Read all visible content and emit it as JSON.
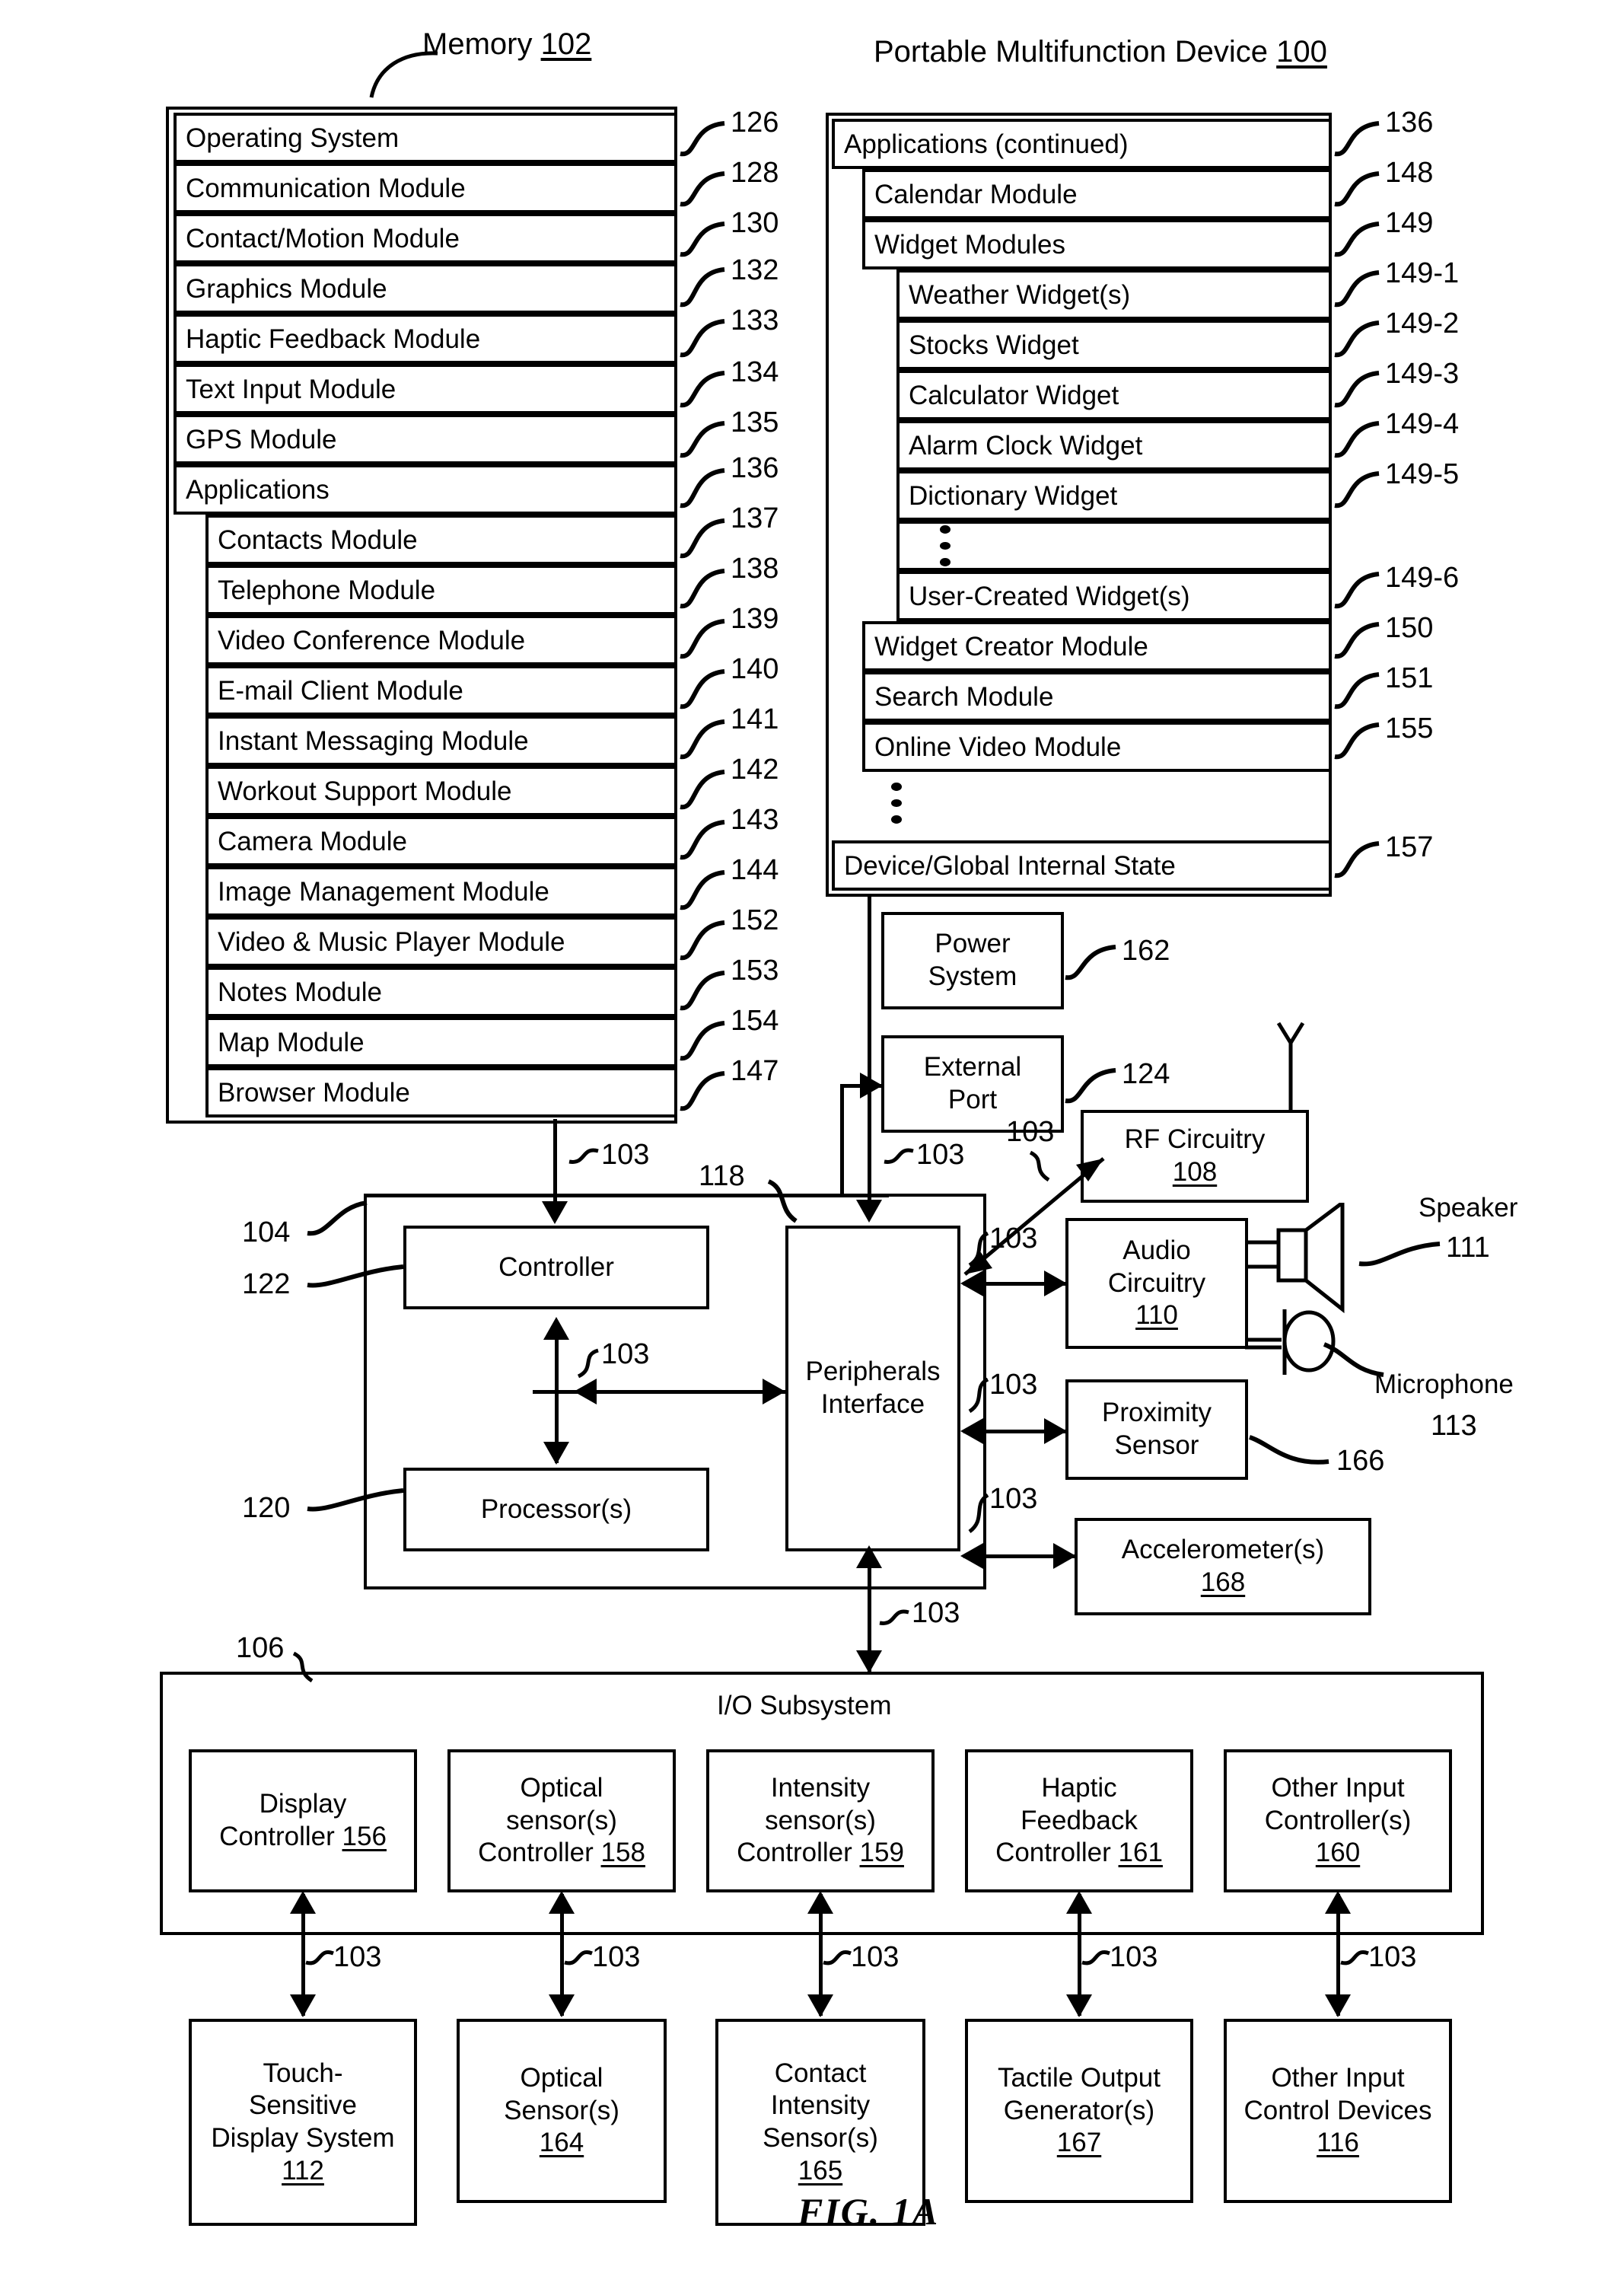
{
  "figure": {
    "caption": "FIG. 1A"
  },
  "memory": {
    "title": "Memory",
    "ref": "102",
    "rows": [
      {
        "label": "Operating System",
        "ref": "126"
      },
      {
        "label": "Communication Module",
        "ref": "128"
      },
      {
        "label": "Contact/Motion Module",
        "ref": "130"
      },
      {
        "label": "Graphics Module",
        "ref": "132"
      },
      {
        "label": "Haptic Feedback Module",
        "ref": "133"
      },
      {
        "label": "Text Input Module",
        "ref": "134"
      },
      {
        "label": "GPS Module",
        "ref": "135"
      },
      {
        "label": "Applications",
        "ref": "136"
      },
      {
        "label": "Contacts Module",
        "ref": "137"
      },
      {
        "label": "Telephone Module",
        "ref": "138"
      },
      {
        "label": "Video Conference Module",
        "ref": "139"
      },
      {
        "label": "E-mail Client Module",
        "ref": "140"
      },
      {
        "label": "Instant Messaging Module",
        "ref": "141"
      },
      {
        "label": "Workout Support Module",
        "ref": "142"
      },
      {
        "label": "Camera Module",
        "ref": "143"
      },
      {
        "label": "Image Management Module",
        "ref": "144"
      },
      {
        "label": "Video & Music Player Module",
        "ref": "152"
      },
      {
        "label": "Notes Module",
        "ref": "153"
      },
      {
        "label": "Map Module",
        "ref": "154"
      },
      {
        "label": "Browser Module",
        "ref": "147"
      }
    ]
  },
  "device": {
    "title": "Portable Multifunction Device",
    "ref": "100",
    "rows": [
      {
        "label": "Applications (continued)",
        "ref": "136"
      },
      {
        "label": "Calendar Module",
        "ref": "148"
      },
      {
        "label": "Widget Modules",
        "ref": "149"
      },
      {
        "label": "Weather Widget(s)",
        "ref": "149-1"
      },
      {
        "label": "Stocks Widget",
        "ref": "149-2"
      },
      {
        "label": "Calculator Widget",
        "ref": "149-3"
      },
      {
        "label": "Alarm Clock Widget",
        "ref": "149-4"
      },
      {
        "label": "Dictionary Widget",
        "ref": "149-5"
      },
      {
        "label": "User-Created Widget(s)",
        "ref": "149-6"
      },
      {
        "label": "Widget Creator Module",
        "ref": "150"
      },
      {
        "label": "Search Module",
        "ref": "151"
      },
      {
        "label": "Online Video Module",
        "ref": "155"
      },
      {
        "label": "Device/Global Internal State",
        "ref": "157"
      }
    ]
  },
  "core": {
    "cpu_ref": "104",
    "controller": {
      "label": "Controller",
      "ref": "122"
    },
    "processors": {
      "label": "Processor(s)",
      "ref": "120"
    },
    "peripherals": {
      "label_line1": "Peripherals",
      "label_line2": "Interface",
      "ref": "118"
    },
    "bus_ref": "103"
  },
  "peripherals_blocks": {
    "power": {
      "line1": "Power",
      "line2": "System",
      "ref": "162"
    },
    "external": {
      "line1": "External",
      "line2": "Port",
      "ref": "124"
    },
    "rf": {
      "line1": "RF Circuitry",
      "num": "108"
    },
    "audio": {
      "line1": "Audio",
      "line2": "Circuitry",
      "num": "110"
    },
    "proximity": {
      "line1": "Proximity",
      "line2": "Sensor",
      "ref": "166"
    },
    "accel": {
      "line1": "Accelerometer(s)",
      "num": "168"
    },
    "speaker": {
      "label": "Speaker",
      "ref": "111"
    },
    "microphone": {
      "label": "Microphone",
      "ref": "113"
    }
  },
  "io_subsystem": {
    "title": "I/O Subsystem",
    "ref": "106",
    "controllers": [
      {
        "line1": "Display",
        "line2": "",
        "line3": "Controller",
        "num": "156"
      },
      {
        "line1": "Optical",
        "line2": "sensor(s)",
        "line3": "Controller",
        "num": "158"
      },
      {
        "line1": "Intensity",
        "line2": "sensor(s)",
        "line3": "Controller",
        "num": "159"
      },
      {
        "line1": "Haptic",
        "line2": "Feedback",
        "line3": "Controller",
        "num": "161"
      },
      {
        "line1": "Other Input",
        "line2": "Controller(s)",
        "line3": "",
        "num": "160"
      }
    ],
    "devices": [
      {
        "line1": "Touch-",
        "line2": "Sensitive",
        "line3": "Display System",
        "num": "112"
      },
      {
        "line1": "Optical",
        "line2": "Sensor(s)",
        "line3": "",
        "num": "164"
      },
      {
        "line1": "Contact",
        "line2": "Intensity",
        "line3": "Sensor(s)",
        "num": "165"
      },
      {
        "line1": "Tactile Output",
        "line2": "Generator(s)",
        "line3": "",
        "num": "167"
      },
      {
        "line1": "Other Input",
        "line2": "Control Devices",
        "line3": "",
        "num": "116"
      }
    ],
    "bus_ref": "103"
  }
}
